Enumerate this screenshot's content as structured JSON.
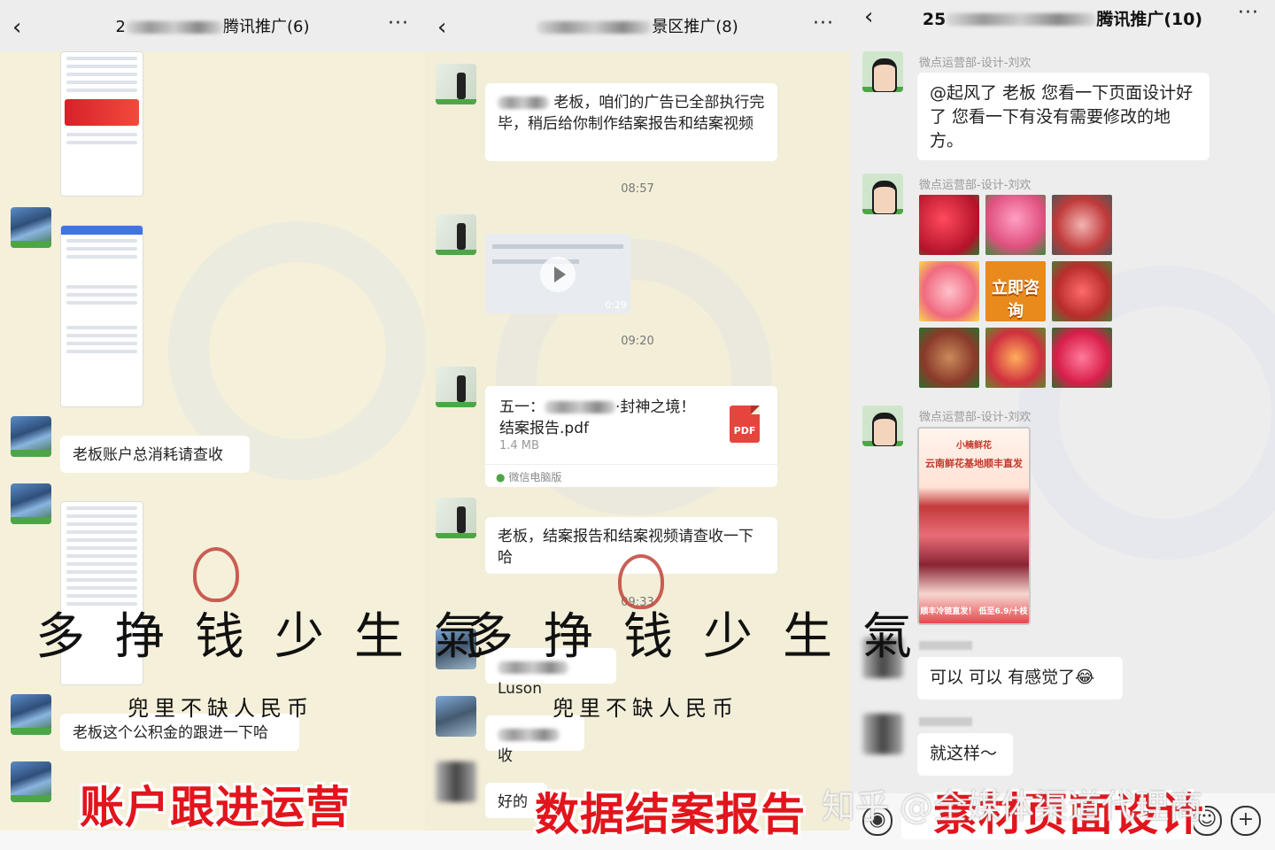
{
  "panels": [
    {
      "title_prefix": "2",
      "title_suffix": "腾讯推广(6)",
      "more": "···",
      "messages": {
        "msg1": "老板账户总消耗请查收",
        "msg2": "老板这个公积金的跟进一下哈"
      },
      "overlay": "账户跟进运营"
    },
    {
      "title_suffix": "景区推广(8)",
      "more": "···",
      "messages": {
        "msg1": "老板，咱们的广告已全部执行完毕，稍后给你制作结案报告和结案视频",
        "msg2": "老板，结案报告和结案视频请查收一下哈",
        "msg3_tail": "Luson",
        "msg4_tail": "收",
        "msg5": "好的"
      },
      "times": [
        "08:57",
        "09:20",
        "09:33"
      ],
      "video_duration": "0:29",
      "file": {
        "name_line1_a": "五一：",
        "name_line1_b": "·封神之境！",
        "name_line2": "结案报告.pdf",
        "size": "1.4 MB",
        "source": "微信电脑版",
        "icon_label": "PDF"
      },
      "overlay": "数据结案报告"
    },
    {
      "badge": "2",
      "title_prefix": "25",
      "title_suffix": "腾讯推广(10)",
      "more": "···",
      "sender": "微点运营部-设计-刘欢",
      "messages": {
        "msg1": "@起风了 老板 您看一下页面设计好了  您看一下有没有需要修改的地方。",
        "msg2": "可以 可以 有感觉了😂",
        "msg3": "就这样～"
      },
      "tile_label": "立即咨询",
      "poster": {
        "line1": "小楠鲜花",
        "line2": "云南鲜花基地顺丰直发",
        "bottom": "顺丰冷链直发！ 低至6.9/十枝"
      },
      "overlay": "素材页面设计"
    }
  ],
  "calligraphy": {
    "main": "多挣钱少生氣",
    "sub": "兜里不缺人民币"
  },
  "watermark": "知乎 @全媒体渠道代理商"
}
